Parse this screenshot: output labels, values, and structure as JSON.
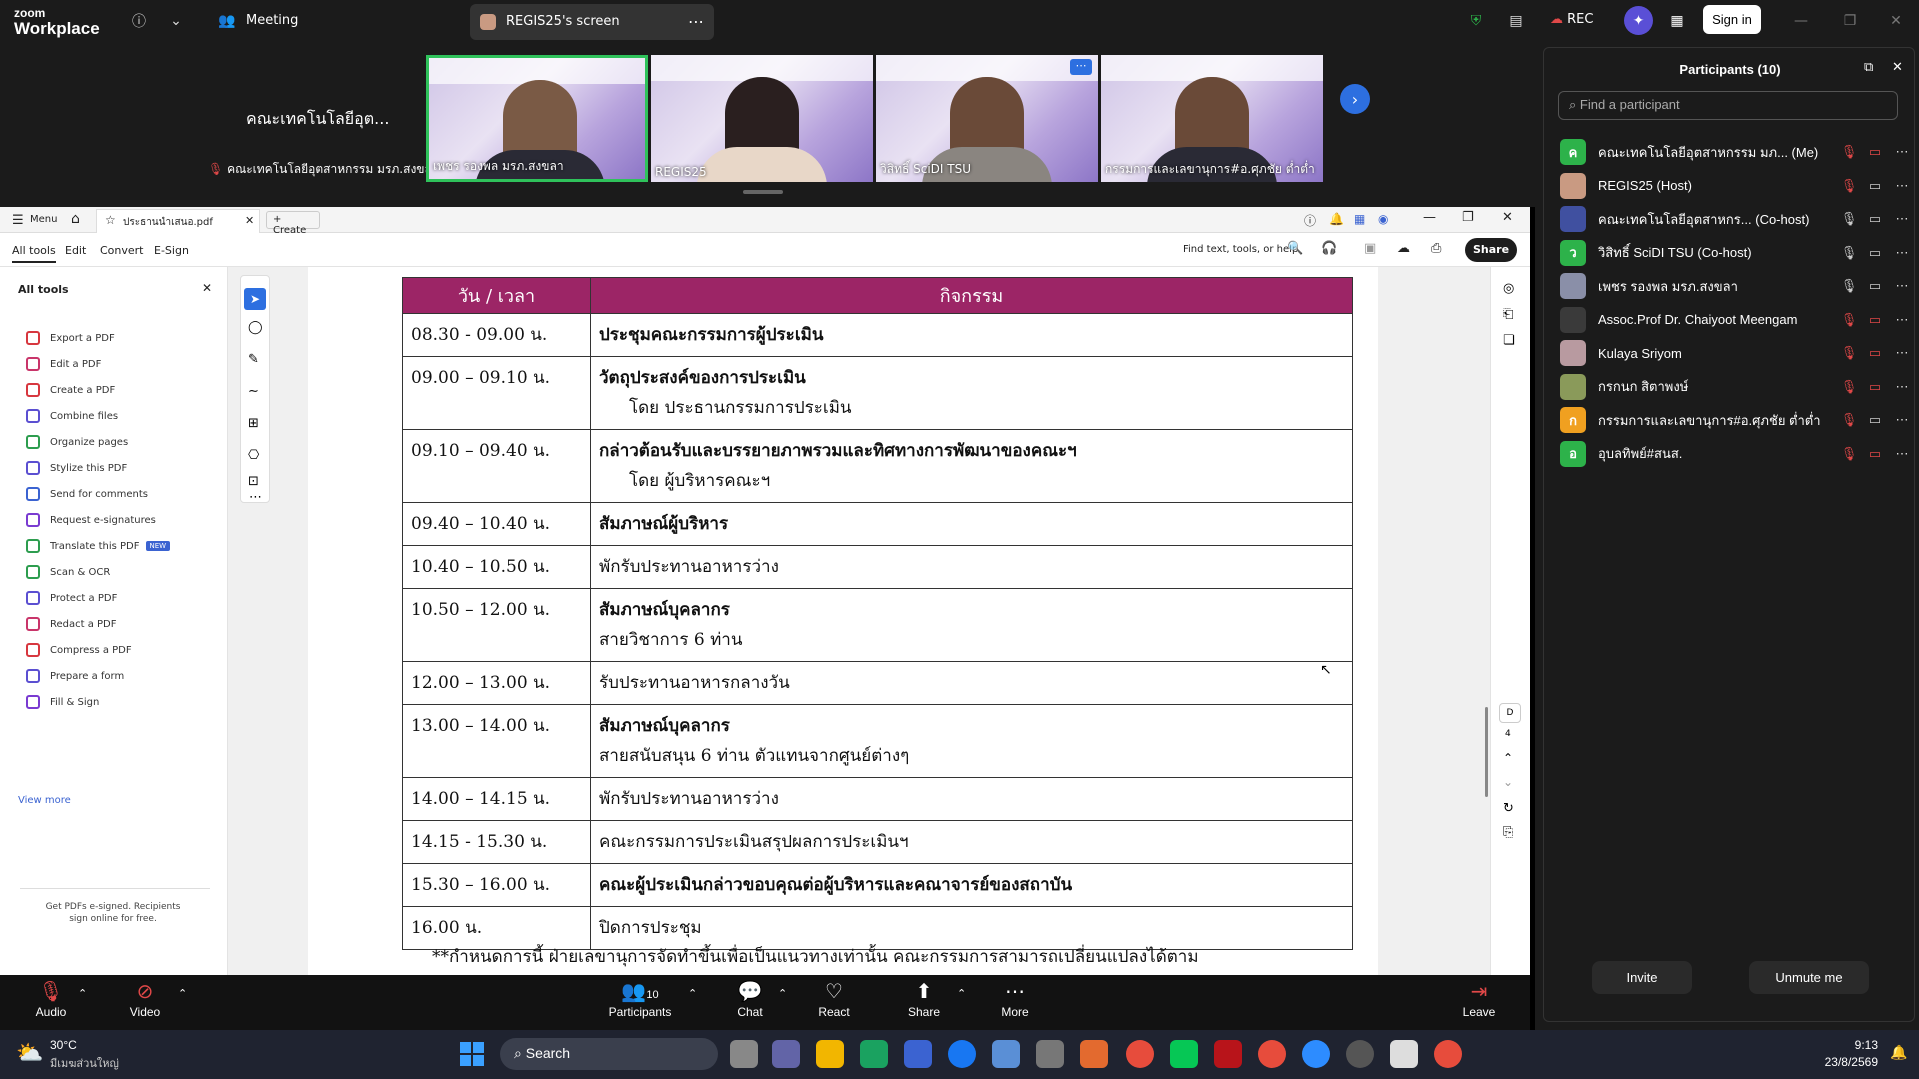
{
  "zoom_top": {
    "logo_line1": "zoom",
    "logo_line2": "Workplace",
    "meeting_label": "Meeting",
    "share_tab_label": "REGIS25's screen",
    "rec_label": "REC",
    "signin_label": "Sign in"
  },
  "gallery": {
    "active_speaker_name": "คณะเทคโนโลยีอุต...",
    "active_speaker_caption": "คณะเทคโนโลยีอุตสาหกรรม มรภ.สงขลา",
    "tiles": [
      {
        "name": "เพชร รองพล มรภ.สงขลา"
      },
      {
        "name": "REGIS25"
      },
      {
        "name": "วิสิทธิ์ SciDI TSU"
      },
      {
        "name": "กรรมการและเลขานุการ#อ.ศุภชัย ต่ำต่ำ"
      }
    ]
  },
  "pdf": {
    "menu_label": "Menu",
    "file_tab": "ประธานนำเสนอ.pdf",
    "create_label": "Create",
    "menu_tabs": [
      "All tools",
      "Edit",
      "Convert",
      "E-Sign"
    ],
    "search_placeholder": "Find text, tools, or help",
    "share_label": "Share",
    "all_tools_title": "All tools",
    "tools": [
      {
        "label": "Export a PDF",
        "color": "#d7373f"
      },
      {
        "label": "Edit a PDF",
        "color": "#c9356a"
      },
      {
        "label": "Create a PDF",
        "color": "#d7373f"
      },
      {
        "label": "Combine files",
        "color": "#5b4fd1"
      },
      {
        "label": "Organize pages",
        "color": "#2d9d4f"
      },
      {
        "label": "Stylize this PDF",
        "color": "#5b4fd1"
      },
      {
        "label": "Send for comments",
        "color": "#3b63d1"
      },
      {
        "label": "Request e-signatures",
        "color": "#7a3bd1"
      },
      {
        "label": "Translate this PDF",
        "color": "#2d9d4f",
        "badge": "NEW"
      },
      {
        "label": "Scan & OCR",
        "color": "#2d9d4f"
      },
      {
        "label": "Protect a PDF",
        "color": "#5b4fd1"
      },
      {
        "label": "Redact a PDF",
        "color": "#c9356a"
      },
      {
        "label": "Compress a PDF",
        "color": "#d7373f"
      },
      {
        "label": "Prepare a form",
        "color": "#5b4fd1"
      },
      {
        "label": "Fill & Sign",
        "color": "#7a3bd1"
      }
    ],
    "view_more": "View more",
    "esign_promo": "Get PDFs e-signed. Recipients sign online for free.",
    "page_number": "4",
    "page_letter": "D",
    "table": {
      "headers": [
        "วัน / เวลา",
        "กิจกรรม"
      ],
      "rows": [
        {
          "time": "08.30 - 09.00 น.",
          "line1": "ประชุมคณะกรรมการผู้ประเมิน",
          "line2": "",
          "bold": true
        },
        {
          "time": "09.00 – 09.10 น.",
          "line1": "วัตถุประสงค์ของการประเมิน",
          "line2": "โดย ประธานกรรมการประเมิน",
          "bold": true
        },
        {
          "time": "09.10 – 09.40 น.",
          "line1": "กล่าวต้อนรับและบรรยายภาพรวมและทิศทางการพัฒนาของคณะฯ",
          "line2": "โดย ผู้บริหารคณะฯ",
          "bold": true
        },
        {
          "time": "09.40 – 10.40 น.",
          "line1": "สัมภาษณ์ผู้บริหาร",
          "line2": "",
          "bold": true
        },
        {
          "time": "10.40 – 10.50 น.",
          "line1": "พักรับประทานอาหารว่าง",
          "line2": "",
          "bold": false
        },
        {
          "time": "10.50 – 12.00 น.",
          "line1": "สัมภาษณ์บุคลากร",
          "line2": "สายวิชาการ  6 ท่าน",
          "bold": true
        },
        {
          "time": "12.00 – 13.00 น.",
          "line1": "รับประทานอาหารกลางวัน",
          "line2": "",
          "bold": false
        },
        {
          "time": "13.00 – 14.00 น.",
          "line1": "สัมภาษณ์บุคลากร",
          "line2": "สายสนับสนุน 6 ท่าน ตัวแทนจากศูนย์ต่างๆ",
          "bold": true
        },
        {
          "time": "14.00 – 14.15 น.",
          "line1": "พักรับประทานอาหารว่าง",
          "line2": "",
          "bold": false
        },
        {
          "time": "14.15 - 15.30 น.",
          "line1": "คณะกรรมการประเมินสรุปผลการประเมินฯ",
          "line2": "",
          "bold": false
        },
        {
          "time": "15.30 – 16.00 น.",
          "line1": "คณะผู้ประเมินกล่าวขอบคุณต่อผู้บริหารและคณาจารย์ของสถาบัน",
          "line2": "",
          "bold": true
        },
        {
          "time": "16.00 น.",
          "line1": "ปิดการประชุม",
          "line2": "",
          "bold": false
        }
      ],
      "note": "**กำหนดการนี้ ฝ่ายเลขานุการจัดทำขึ้นเพื่อเป็นแนวทางเท่านั้น คณะกรรมการสามารถเปลี่ยนแปลงได้ตาม"
    }
  },
  "zoom_controls": {
    "audio": "Audio",
    "video": "Video",
    "participants": "Participants",
    "participants_count": "10",
    "chat": "Chat",
    "react": "React",
    "share": "Share",
    "more": "More",
    "leave": "Leave"
  },
  "participants_panel": {
    "title": "Participants (10)",
    "search_placeholder": "Find a participant",
    "list": [
      {
        "name": "คณะเทคโนโลยีอุตสาหกรรม มภ... (Me)",
        "avatar_letter": "ค",
        "avatar_color": "#2db24a"
      },
      {
        "name": "REGIS25 (Host)",
        "avatar_letter": "",
        "avatar_color": "#c99a82"
      },
      {
        "name": "คณะเทคโนโลยีอุตสาหกร...  (Co-host)",
        "avatar_letter": "",
        "avatar_color": "#4050a0"
      },
      {
        "name": "วิสิทธิ์ SciDI TSU (Co-host)",
        "avatar_letter": "ว",
        "avatar_color": "#2db24a"
      },
      {
        "name": "เพชร รองพล มรภ.สงขลา",
        "avatar_letter": "",
        "avatar_color": "#8a8fa8"
      },
      {
        "name": "Assoc.Prof Dr. Chaiyoot Meengam",
        "avatar_letter": "",
        "avatar_color": "#3a3a3a"
      },
      {
        "name": "Kulaya Sriyom",
        "avatar_letter": "",
        "avatar_color": "#b89aa0"
      },
      {
        "name": "กรกนก สิตาพงษ์",
        "avatar_letter": "",
        "avatar_color": "#8a9a5a"
      },
      {
        "name": "กรรมการและเลขานุการ#อ.ศุภชัย ต่ำต่ำ",
        "avatar_letter": "ก",
        "avatar_color": "#f0a020"
      },
      {
        "name": "อุบลทิพย์#สนส.",
        "avatar_letter": "อ",
        "avatar_color": "#2db24a"
      }
    ],
    "invite_label": "Invite",
    "unmute_label": "Unmute me"
  },
  "taskbar": {
    "weather_temp": "30°C",
    "weather_desc": "มีเมฆส่วนใหญ่",
    "search_label": "Search",
    "time": "9:13",
    "date": "23/8/2569"
  }
}
